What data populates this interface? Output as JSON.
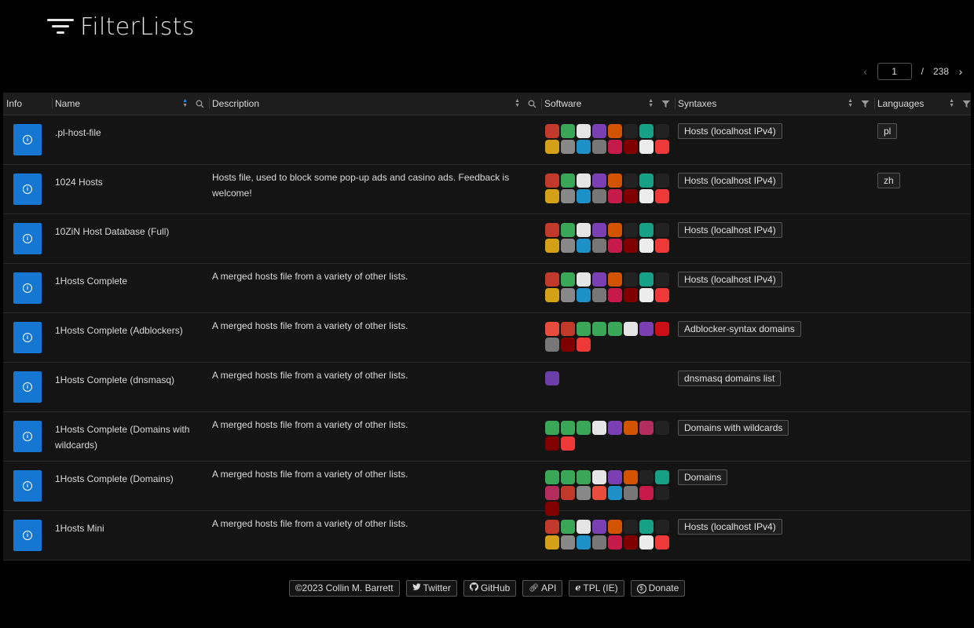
{
  "app": {
    "title": "FilterLists"
  },
  "pager": {
    "current": "1",
    "separator": "/",
    "total": "238"
  },
  "columns": {
    "info": "Info",
    "name": "Name",
    "description": "Description",
    "software": "Software",
    "syntaxes": "Syntaxes",
    "languages": "Languages"
  },
  "rows": [
    {
      "name": ".pl-host-file",
      "description": "",
      "syntax": "Hosts (localhost IPv4)",
      "language": "pl",
      "software_set": "hosts"
    },
    {
      "name": "1024 Hosts",
      "description": "Hosts file, used to block some pop-up ads and casino ads. Feedback is welcome!",
      "syntax": "Hosts (localhost IPv4)",
      "language": "zh",
      "software_set": "hosts"
    },
    {
      "name": "10ZiN Host Database (Full)",
      "description": "",
      "syntax": "Hosts (localhost IPv4)",
      "language": "",
      "software_set": "hosts"
    },
    {
      "name": "1Hosts Complete",
      "description": "A merged hosts file from a variety of other lists.",
      "syntax": "Hosts (localhost IPv4)",
      "language": "",
      "software_set": "hosts"
    },
    {
      "name": "1Hosts Complete (Adblockers)",
      "description": "A merged hosts file from a variety of other lists.",
      "syntax": "Adblocker-syntax domains",
      "language": "",
      "software_set": "adblock"
    },
    {
      "name": "1Hosts Complete (dnsmasq)",
      "description": "A merged hosts file from a variety of other lists.",
      "syntax": "dnsmasq domains list",
      "language": "",
      "software_set": "dnsmasq"
    },
    {
      "name": "1Hosts Complete (Domains with wildcards)",
      "description": "A merged hosts file from a variety of other lists.",
      "syntax": "Domains with wildcards",
      "language": "",
      "software_set": "wildcards"
    },
    {
      "name": "1Hosts Complete (Domains)",
      "description": "A merged hosts file from a variety of other lists.",
      "syntax": "Domains",
      "language": "",
      "software_set": "domains"
    },
    {
      "name": "1Hosts Mini",
      "description": "A merged hosts file from a variety of other lists.",
      "syntax": "Hosts (localhost IPv4)",
      "language": "",
      "software_set": "hosts"
    }
  ],
  "software_icons": {
    "hosts": [
      {
        "name": "dnscrypt-icon",
        "color": "#c0392b"
      },
      {
        "name": "adaway-icon",
        "color": "#3aa657"
      },
      {
        "name": "pihole-icon",
        "color": "#e5e5e5"
      },
      {
        "name": "privoxy-icon",
        "color": "#7b3fb4"
      },
      {
        "name": "blokada-icon",
        "color": "#d35400"
      },
      {
        "name": "phone-icon",
        "color": "#222"
      },
      {
        "name": "dnsmasq-icon",
        "color": "#16a085"
      },
      {
        "name": "hostsman-icon",
        "color": "#222"
      },
      {
        "name": "hostsfile-editor-icon",
        "color": "#d4a017"
      },
      {
        "name": "gas-mask-icon",
        "color": "#888"
      },
      {
        "name": "personaldns-icon",
        "color": "#1e90c8"
      },
      {
        "name": "pfblocker-icon",
        "color": "#777"
      },
      {
        "name": "raspberry-icon",
        "color": "#c51a4a"
      },
      {
        "name": "ublock-icon",
        "color": "#800000"
      },
      {
        "name": "hosts-editor-icon",
        "color": "#ececec"
      },
      {
        "name": "vivaldi-icon",
        "color": "#ef3939"
      }
    ],
    "adblock": [
      {
        "name": "adblock-icon",
        "color": "#e74c3c"
      },
      {
        "name": "abp-icon",
        "color": "#c0392b"
      },
      {
        "name": "adaway-icon",
        "color": "#3aa657"
      },
      {
        "name": "adguard-icon",
        "color": "#3aa657"
      },
      {
        "name": "adguard-home-icon",
        "color": "#3aa657"
      },
      {
        "name": "pihole-icon",
        "color": "#e5e5e5"
      },
      {
        "name": "privoxy-icon",
        "color": "#7b3fb4"
      },
      {
        "name": "opera-icon",
        "color": "#cc0f16"
      },
      {
        "name": "pfblocker-icon",
        "color": "#777"
      },
      {
        "name": "ublock-icon",
        "color": "#800000"
      },
      {
        "name": "vivaldi-icon",
        "color": "#ef3939"
      }
    ],
    "dnsmasq": [
      {
        "name": "dnsmasq-mask-icon",
        "color": "#6c3fa8"
      }
    ],
    "wildcards": [
      {
        "name": "adaway-icon",
        "color": "#3aa657"
      },
      {
        "name": "adguard-icon",
        "color": "#3aa657"
      },
      {
        "name": "adguard-home-icon",
        "color": "#3aa657"
      },
      {
        "name": "pihole-icon",
        "color": "#e5e5e5"
      },
      {
        "name": "privoxy-icon",
        "color": "#7b3fb4"
      },
      {
        "name": "blokada-icon",
        "color": "#d35400"
      },
      {
        "name": "littlesnitch-icon",
        "color": "#b32d5c"
      },
      {
        "name": "mask-icon",
        "color": "#222"
      },
      {
        "name": "ublock-icon",
        "color": "#800000"
      },
      {
        "name": "vivaldi-icon",
        "color": "#ef3939"
      }
    ],
    "domains": [
      {
        "name": "adaway-icon",
        "color": "#3aa657"
      },
      {
        "name": "adguard-icon",
        "color": "#3aa657"
      },
      {
        "name": "adguard-home-icon",
        "color": "#3aa657"
      },
      {
        "name": "pihole-icon",
        "color": "#e5e5e5"
      },
      {
        "name": "privoxy-icon",
        "color": "#7b3fb4"
      },
      {
        "name": "blokada-icon",
        "color": "#d35400"
      },
      {
        "name": "phone-icon",
        "color": "#222"
      },
      {
        "name": "dnsmasq-icon",
        "color": "#16a085"
      },
      {
        "name": "littlesnitch-icon",
        "color": "#b32d5c"
      },
      {
        "name": "js-icon",
        "color": "#c0392b"
      },
      {
        "name": "gas-mask-icon",
        "color": "#888"
      },
      {
        "name": "adblock-icon",
        "color": "#e74c3c"
      },
      {
        "name": "personaldns-icon",
        "color": "#1e90c8"
      },
      {
        "name": "pfblocker-icon",
        "color": "#777"
      },
      {
        "name": "raspberry-icon",
        "color": "#c51a4a"
      },
      {
        "name": "mask-icon",
        "color": "#222"
      },
      {
        "name": "ublock-icon",
        "color": "#800000"
      }
    ]
  },
  "footer": {
    "copyright": "©2023 Collin M. Barrett",
    "twitter": "Twitter",
    "github": "GitHub",
    "api": "API",
    "tpl": "TPL (IE)",
    "donate": "Donate"
  }
}
